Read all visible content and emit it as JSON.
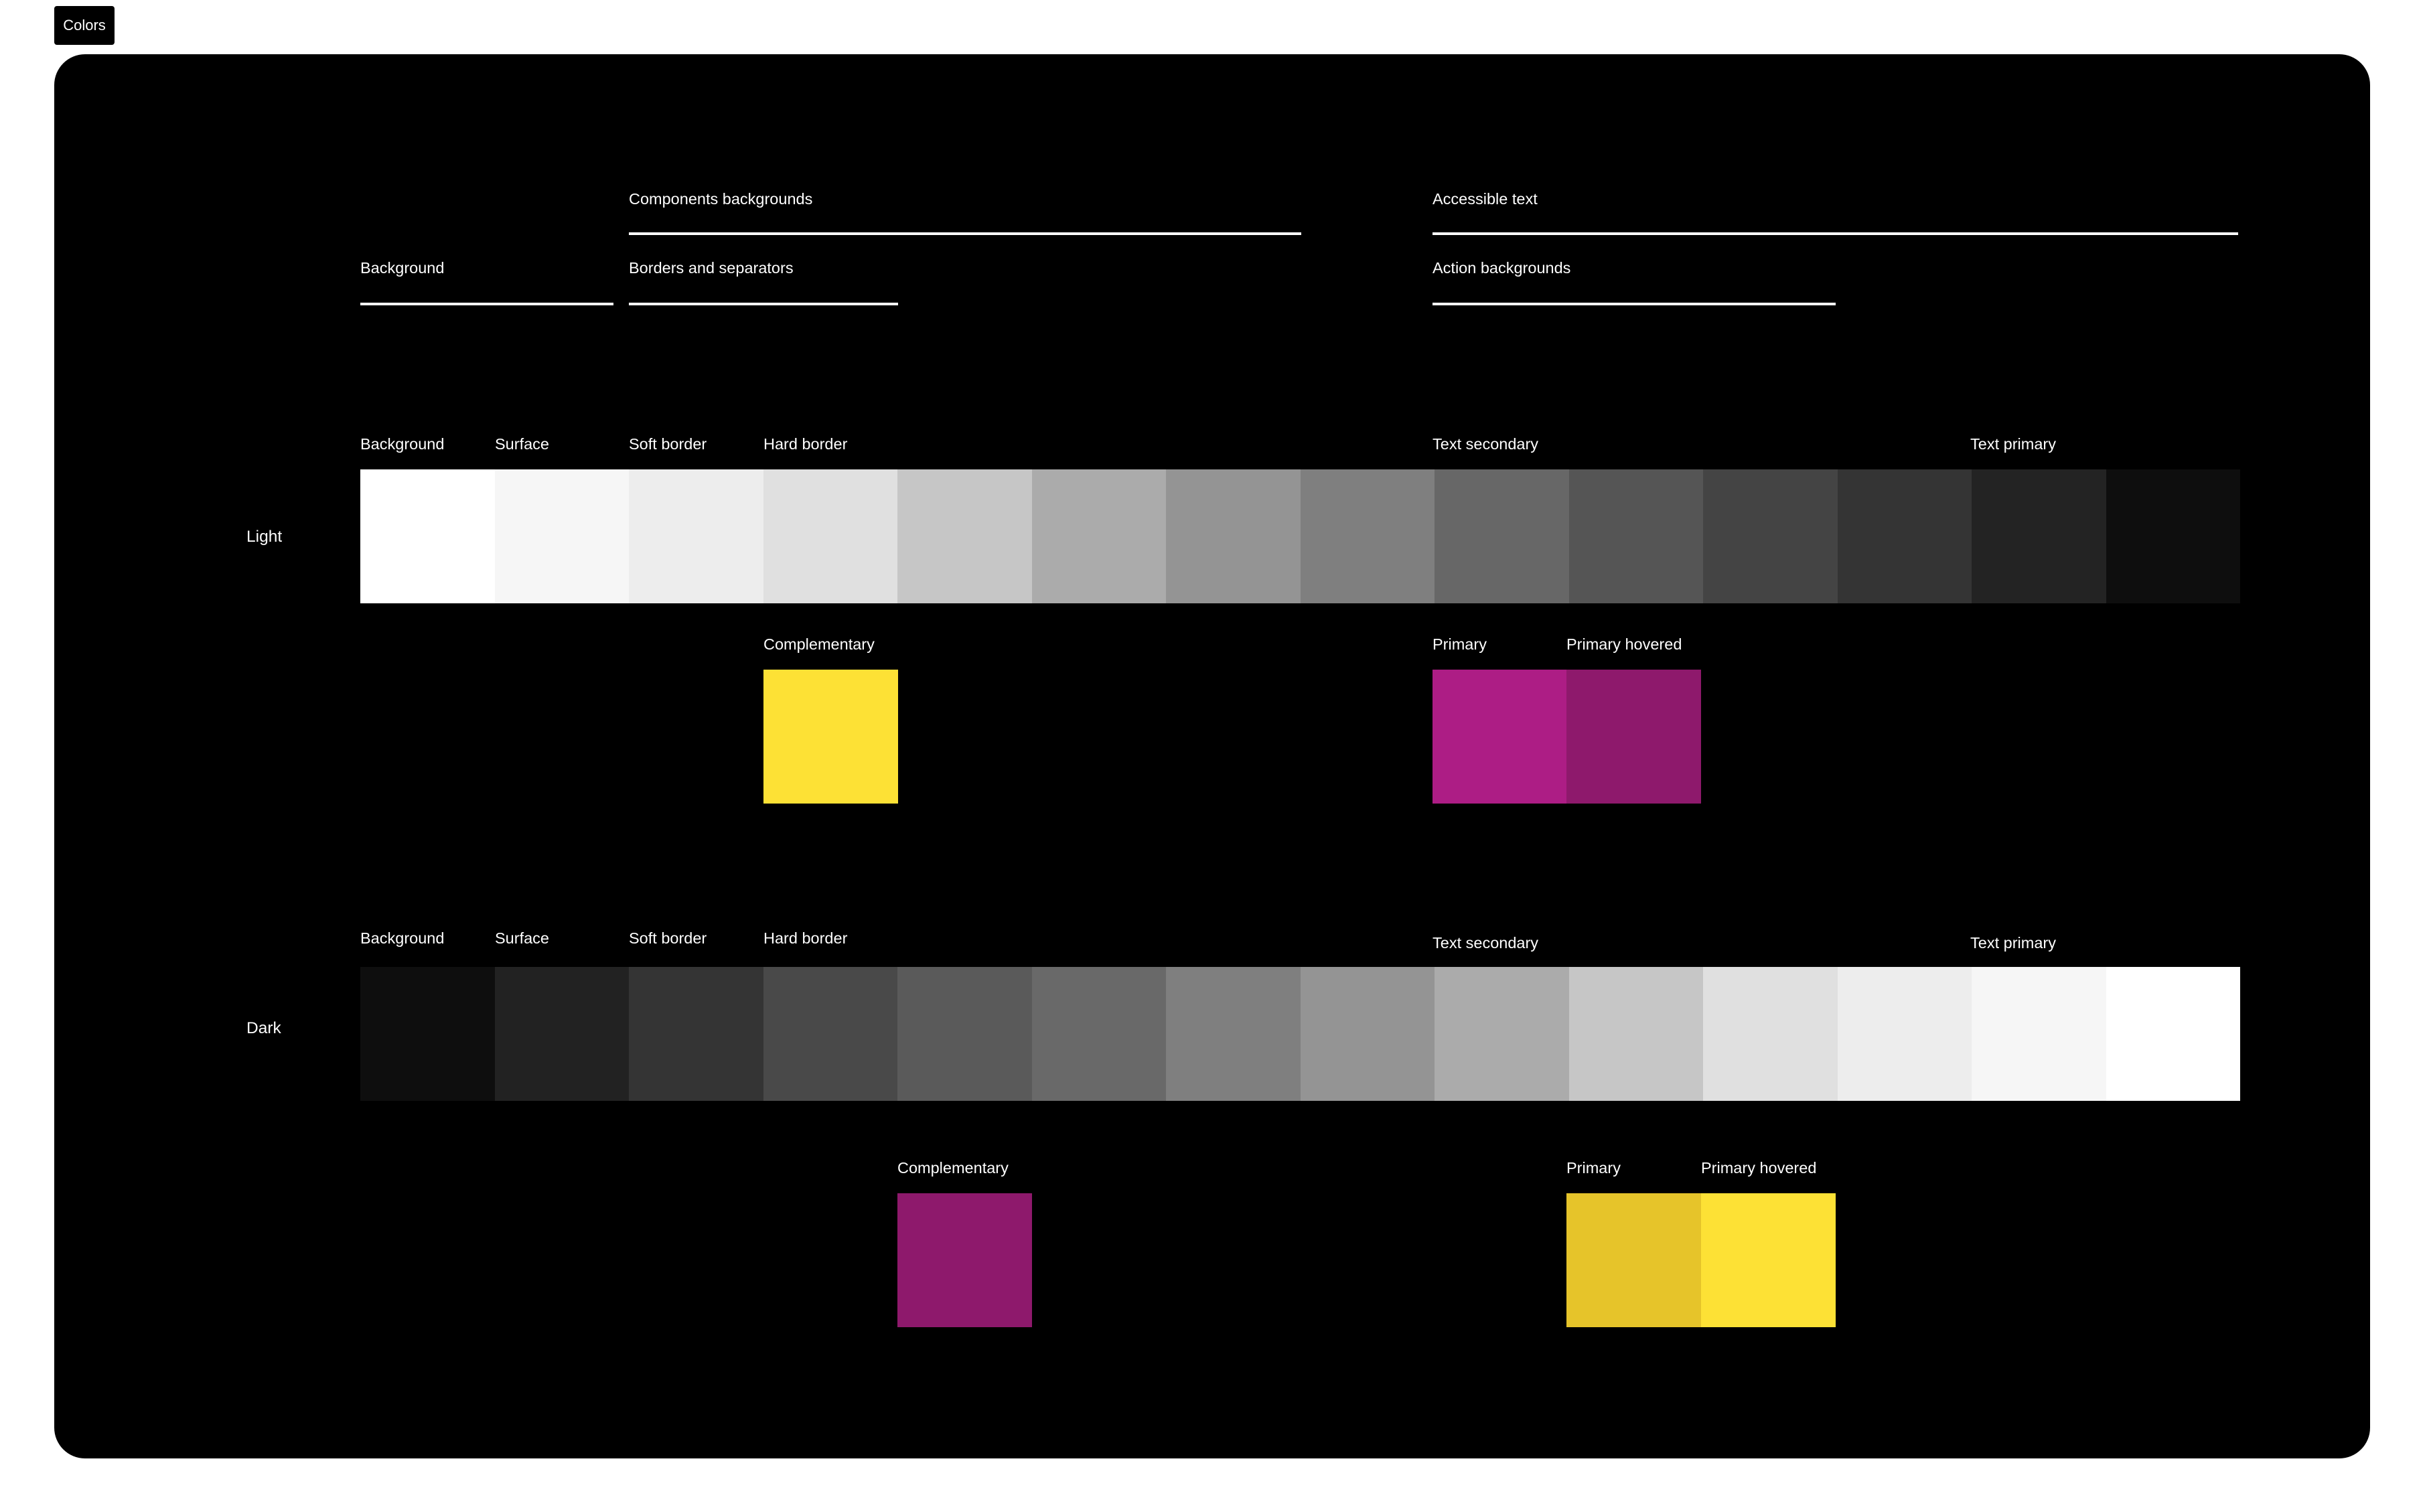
{
  "frame": {
    "tag": "Colors"
  },
  "legend": {
    "components_backgrounds": "Components backgrounds",
    "accessible_text": "Accessible text",
    "background": "Background",
    "borders_and_separators": "Borders and separators",
    "action_backgrounds": "Action backgrounds"
  },
  "light": {
    "row_label": "Light",
    "labels": {
      "background": "Background",
      "surface": "Surface",
      "soft_border": "Soft border",
      "hard_border": "Hard border",
      "text_secondary": "Text secondary",
      "text_primary": "Text primary",
      "complementary": "Complementary",
      "primary": "Primary",
      "primary_hovered": "Primary hovered"
    },
    "ramp": [
      "#ffffff",
      "#f6f6f6",
      "#ededed",
      "#e0e0e0",
      "#c6c6c6",
      "#ababab",
      "#949494",
      "#7f7f7f",
      "#676767",
      "#555555",
      "#444444",
      "#343434",
      "#232323",
      "#0e0e0e"
    ],
    "complementary_color": "#fde135",
    "primary_color": "#ad1d85",
    "primary_hovered_color": "#8e196c"
  },
  "dark": {
    "row_label": "Dark",
    "labels": {
      "background": "Background",
      "surface": "Surface",
      "soft_border": "Soft border",
      "hard_border": "Hard border",
      "text_secondary": "Text secondary",
      "text_primary": "Text primary",
      "complementary": "Complementary",
      "primary": "Primary",
      "primary_hovered": "Primary hovered"
    },
    "ramp": [
      "#0e0e0e",
      "#222222",
      "#343434",
      "#494949",
      "#5a5a5a",
      "#696969",
      "#7f7f7f",
      "#949494",
      "#ababab",
      "#c6c6c6",
      "#e0e0e0",
      "#ededed",
      "#f6f6f6",
      "#ffffff"
    ],
    "complementary_color": "#8e196c",
    "primary_color": "#e6c42a",
    "primary_hovered_color": "#fde135"
  }
}
